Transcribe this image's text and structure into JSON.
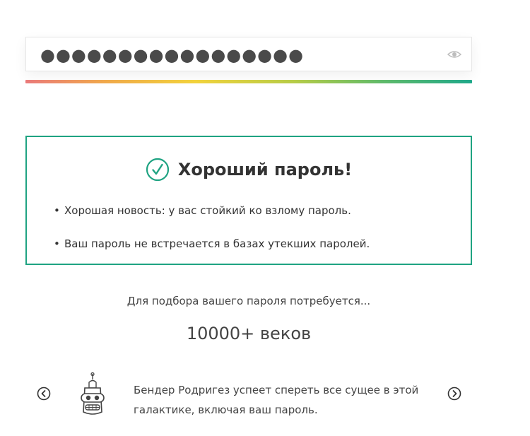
{
  "password": {
    "masked_value": "●●●●●●●●●●●●●●●●●",
    "strength_level": 1.0
  },
  "result": {
    "title": "Хороший пароль!",
    "items": [
      "Хорошая новость: у вас стойкий ко взлому пароль.",
      "Ваш пароль не встречается в базах утекших паролей."
    ],
    "accent_color": "#1fa382"
  },
  "crack": {
    "caption": "Для подбора вашего пароля потребуется...",
    "time": "10000+ веков"
  },
  "carousel": {
    "text_line1": "Бендер Родригез успеет спереть все сущее в этой",
    "text_line2": "галактике, включая ваш пароль."
  },
  "icons": [
    "eye-icon",
    "check-circle-icon",
    "arrow-left-icon",
    "arrow-right-icon",
    "bender-robot-icon"
  ]
}
